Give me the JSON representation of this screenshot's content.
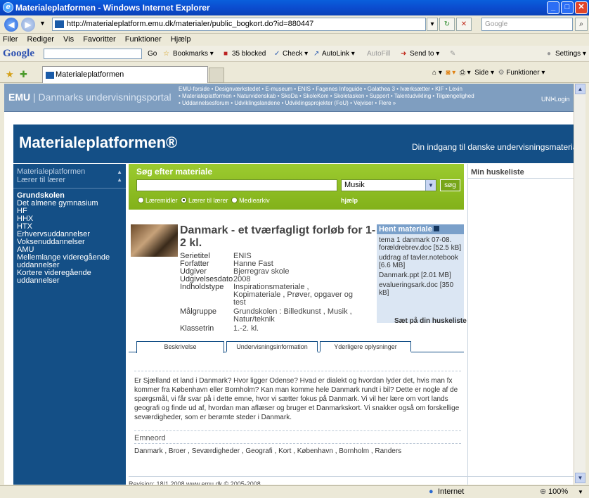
{
  "browser": {
    "window_title": "Materialeplatformen - Windows Internet Explorer",
    "url": "http://materialeplatform.emu.dk/materialer/public_bogkort.do?id=880447",
    "search_placeholder": "Google",
    "menu": [
      "Filer",
      "Rediger",
      "Vis",
      "Favoritter",
      "Funktioner",
      "Hjælp"
    ],
    "google_toolbar": {
      "logo": "Google",
      "go": "Go",
      "bookmarks": "Bookmarks ▾",
      "blocked": "35 blocked",
      "check": "Check ▾",
      "autolink": "AutoLink ▾",
      "autofill": "AutoFill",
      "sendto": "Send to ▾",
      "settings": "Settings ▾"
    },
    "tab_title": "Materialeplatformen",
    "command_bar": {
      "side": "Side ▾",
      "funktioner": "Funktioner ▾"
    },
    "status": {
      "zone": "Internet",
      "zoom": "100%"
    }
  },
  "site": {
    "logo_emu": "EMU",
    "logo_sep": " | ",
    "logo_text": "Danmarks undervisningsportal",
    "top_links": [
      "EMU-forside • Designværkstedet • E-museum • ENIS • Fagenes Infoguide • Galathea 3 • Iværksætter • KIF • Lexin",
      "• Materialeplatformen • Naturvidenskab • SkoDa • SkoleKom • Skoletasken • Support • Talentudvikling • Tilgængelighed",
      "• Uddannelsesforum • Udviklingslandene • Udviklingsprojekter (FoU) • Vejviser • Flere »"
    ],
    "unilogin": "UNI•Login",
    "banner_title": "Materialeplatformen®",
    "banner_subtitle": "Din indgang til danske undervisningsmaterialer"
  },
  "leftnav": {
    "header1": "Materialeplatformen",
    "header2": "Lærer til lærer",
    "items": [
      "Grundskolen",
      "Det almene gymnasium",
      "HF",
      "HHX",
      "HTX",
      "Erhvervsuddannelser",
      "Voksenuddannelser",
      "AMU",
      "Mellemlange videregående uddannelser",
      "Kortere videregående uddannelser"
    ]
  },
  "search": {
    "heading": "Søg efter materiale",
    "query": "",
    "category": "Musik",
    "button": "søg",
    "radios": [
      "Læremidler",
      "Lærer til lærer",
      "Mediearkiv"
    ],
    "help": "hjælp"
  },
  "huskeliste": {
    "title": "Min huskeliste"
  },
  "material": {
    "title": "Danmark - et tværfagligt forløb for 1-2 kl.",
    "fields": [
      {
        "label": "Serietitel",
        "value": "ENIS"
      },
      {
        "label": "Forfatter",
        "value": "Hanne Fast"
      },
      {
        "label": "Udgiver",
        "value": "Bjerregrav skole"
      },
      {
        "label": "Udgivelsesdato",
        "value": "2008"
      },
      {
        "label": "Indholdstype",
        "value": "Inspirationsmateriale , Kopimateriale , Prøver, opgaver og test"
      },
      {
        "label": "Målgruppe",
        "value": "Grundskolen : Billedkunst , Musik , Natur/teknik"
      },
      {
        "label": "Klassetrin",
        "value": "1.-2. kl."
      }
    ],
    "download_heading": "Hent materiale",
    "files": [
      "tema 1 danmark 07-08. forældrebrev.doc [52.5 kB]",
      "uddrag af tavler.notebook [6.6 MB]",
      "Danmark.ppt [2.01 MB]",
      "evalueringsark.doc [350 kB]"
    ],
    "add_to_list": "Sæt på din huskeliste",
    "tabs": [
      "Beskrivelse",
      "Undervisningsinformation",
      "Yderligere oplysninger"
    ],
    "description": "Er Sjælland et land i Danmark? Hvor ligger Odense? Hvad er dialekt og hvordan lyder det, hvis man fx kommer fra København eller Bornholm? Kan man komme hele Danmark rundt i bil? Dette er nogle af de spørgsmål, vi får svar på i dette emne, hvor vi sætter fokus på Danmark. Vi vil her lære om vort lands geografi og finde ud af, hvordan man aflæser og bruger et Danmarkskort. Vi snakker også om forskellige seværdigheder, som er berømte steder i Danmark.",
    "emneord_heading": "Emneord",
    "emneord": "Danmark , Broer , Seværdigheder , Geografi , Kort , København , Bornholm , Randers"
  },
  "footer": {
    "text": "Revision: 18/1 2008 www.emu.dk © 2005-2008."
  },
  "colors": {
    "site_blue": "#144f86",
    "search_green": "#8cbc22",
    "top_strip": "#7f9ec0"
  }
}
